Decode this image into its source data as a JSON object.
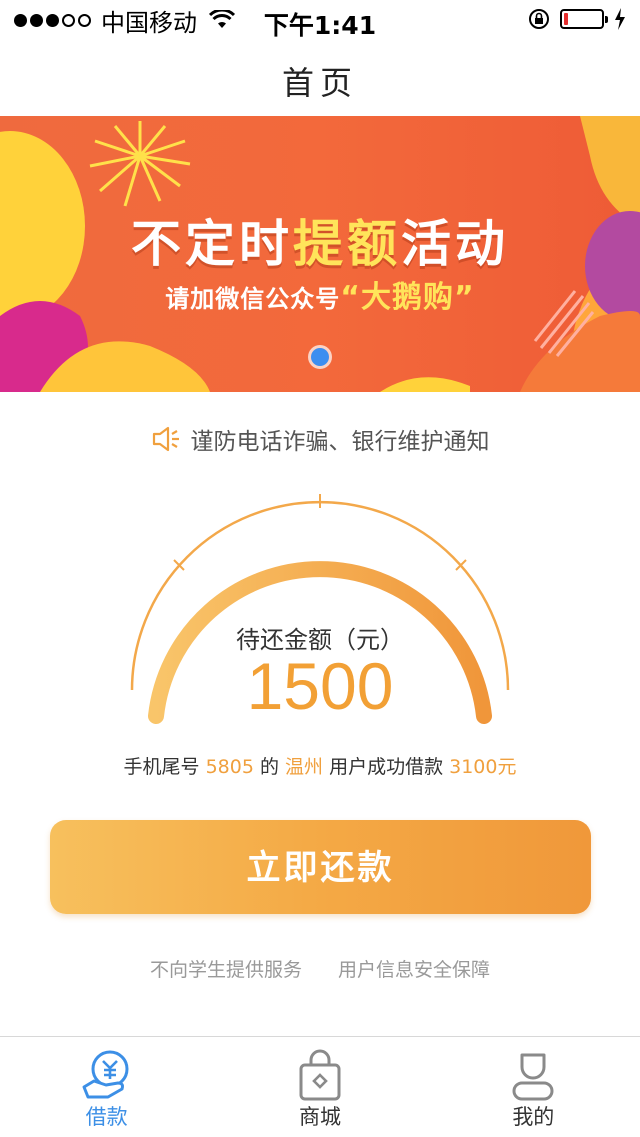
{
  "status_bar": {
    "carrier": "中国移动",
    "time": "下午1:41"
  },
  "nav": {
    "title": "首页"
  },
  "banner": {
    "title_part1": "不定时",
    "title_highlight": "提额",
    "title_part2": "活动",
    "subtitle": "请加微信公众号",
    "subtitle_highlight": "“大鹅购”"
  },
  "notice": {
    "text": "谨防电话诈骗、银行维护通知"
  },
  "gauge": {
    "label": "待还金额（元）",
    "amount": "1500"
  },
  "ticker": {
    "prefix": "手机尾号 ",
    "phone_tail": "5805",
    "mid1": " 的 ",
    "city": "温州",
    "mid2": " 用户成功借款 ",
    "amount": "3100元"
  },
  "repay_button": {
    "label": "立即还款"
  },
  "footer_notes": [
    "不向学生提供服务",
    "用户信息安全保障"
  ],
  "tabs": [
    {
      "label": "借款",
      "icon": "loan-icon",
      "active": true
    },
    {
      "label": "商城",
      "icon": "shopping-bag-icon",
      "active": false
    },
    {
      "label": "我的",
      "icon": "profile-icon",
      "active": false
    }
  ],
  "colors": {
    "accent_orange": "#f2a035",
    "tab_active": "#3c8fe6",
    "banner_bg": "#ef6a3e"
  }
}
